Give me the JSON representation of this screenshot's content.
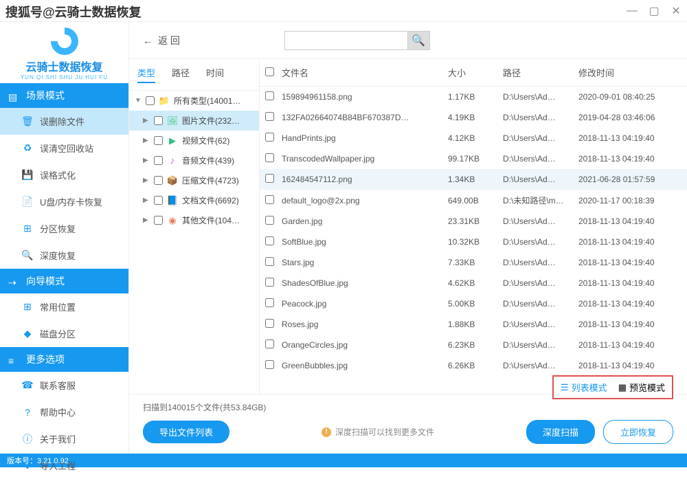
{
  "watermark": "搜狐号@云骑士数据恢复",
  "logo": {
    "title": "云骑士数据恢复",
    "subtitle": "YUN QI SHI SHU JU HUI FU"
  },
  "sidebar": {
    "section1": {
      "title": "场景模式",
      "items": [
        {
          "label": "误删除文件",
          "icon": "🗑"
        },
        {
          "label": "误清空回收站",
          "icon": "♻"
        },
        {
          "label": "误格式化",
          "icon": "💾"
        },
        {
          "label": "U盘/内存卡恢复",
          "icon": "📄"
        },
        {
          "label": "分区恢复",
          "icon": "⊞"
        },
        {
          "label": "深度恢复",
          "icon": "🔍"
        }
      ]
    },
    "section2": {
      "title": "向导模式",
      "items": [
        {
          "label": "常用位置",
          "icon": "⊞"
        },
        {
          "label": "磁盘分区",
          "icon": "◆"
        }
      ]
    },
    "section3": {
      "title": "更多选项",
      "items": [
        {
          "label": "联系客服",
          "icon": "☎"
        },
        {
          "label": "帮助中心",
          "icon": "?"
        },
        {
          "label": "关于我们",
          "icon": "ⓘ"
        },
        {
          "label": "导入工程",
          "icon": "⬇"
        }
      ]
    }
  },
  "toolbar": {
    "back": "返   回"
  },
  "tree": {
    "tabs": [
      "类型",
      "路径",
      "时间"
    ],
    "items": [
      {
        "label": "所有类型(14001…",
        "icon": "📁",
        "cls": "ic-folder",
        "arrow": "▼"
      },
      {
        "label": "图片文件(232…",
        "icon": "🖼",
        "cls": "ic-image",
        "arrow": "▶",
        "selected": true
      },
      {
        "label": "视频文件(62)",
        "icon": "▶",
        "cls": "ic-video",
        "arrow": "▶"
      },
      {
        "label": "音频文件(439)",
        "icon": "♪",
        "cls": "ic-audio",
        "arrow": "▶"
      },
      {
        "label": "压缩文件(4723)",
        "icon": "📦",
        "cls": "ic-zip",
        "arrow": "▶"
      },
      {
        "label": "文档文件(6692)",
        "icon": "📘",
        "cls": "ic-doc",
        "arrow": "▶"
      },
      {
        "label": "其他文件(104…",
        "icon": "◉",
        "cls": "ic-other",
        "arrow": "▶"
      }
    ]
  },
  "fileHeader": {
    "name": "文件名",
    "size": "大小",
    "path": "路径",
    "time": "修改时间"
  },
  "files": [
    {
      "name": "159894961158.png",
      "size": "1.17KB",
      "path": "D:\\Users\\Ad…",
      "time": "2020-09-01 08:40:25"
    },
    {
      "name": "132FA02664074B84BF670387D…",
      "size": "4.19KB",
      "path": "D:\\Users\\Ad…",
      "time": "2019-04-28 03:46:06"
    },
    {
      "name": "HandPrints.jpg",
      "size": "4.12KB",
      "path": "D:\\Users\\Ad…",
      "time": "2018-11-13 04:19:40"
    },
    {
      "name": "TranscodedWallpaper.jpg",
      "size": "99.17KB",
      "path": "D:\\Users\\Ad…",
      "time": "2018-11-13 04:19:40"
    },
    {
      "name": "162484547112.png",
      "size": "1.34KB",
      "path": "D:\\Users\\Ad…",
      "time": "2021-06-28 01:57:59",
      "hl": true
    },
    {
      "name": "default_logo@2x.png",
      "size": "649.00B",
      "path": "D:\\未知路径\\m…",
      "time": "2020-11-17 00:18:39"
    },
    {
      "name": "Garden.jpg",
      "size": "23.31KB",
      "path": "D:\\Users\\Ad…",
      "time": "2018-11-13 04:19:40"
    },
    {
      "name": "SoftBlue.jpg",
      "size": "10.32KB",
      "path": "D:\\Users\\Ad…",
      "time": "2018-11-13 04:19:40"
    },
    {
      "name": "Stars.jpg",
      "size": "7.33KB",
      "path": "D:\\Users\\Ad…",
      "time": "2018-11-13 04:19:40"
    },
    {
      "name": "ShadesOfBlue.jpg",
      "size": "4.62KB",
      "path": "D:\\Users\\Ad…",
      "time": "2018-11-13 04:19:40"
    },
    {
      "name": "Peacock.jpg",
      "size": "5.00KB",
      "path": "D:\\Users\\Ad…",
      "time": "2018-11-13 04:19:40"
    },
    {
      "name": "Roses.jpg",
      "size": "1.88KB",
      "path": "D:\\Users\\Ad…",
      "time": "2018-11-13 04:19:40"
    },
    {
      "name": "OrangeCircles.jpg",
      "size": "6.23KB",
      "path": "D:\\Users\\Ad…",
      "time": "2018-11-13 04:19:40"
    },
    {
      "name": "GreenBubbles.jpg",
      "size": "6.26KB",
      "path": "D:\\Users\\Ad…",
      "time": "2018-11-13 04:19:40"
    }
  ],
  "footer": {
    "scanInfo": "扫描到140015个文件(共53.84GB)",
    "exportBtn": "导出文件列表",
    "hint": "深度扫描可以找到更多文件",
    "deepScan": "深度扫描",
    "recover": "立即恢复",
    "listMode": "列表模式",
    "previewMode": "预览模式"
  },
  "statusbar": "版本号：3.21.0.92"
}
